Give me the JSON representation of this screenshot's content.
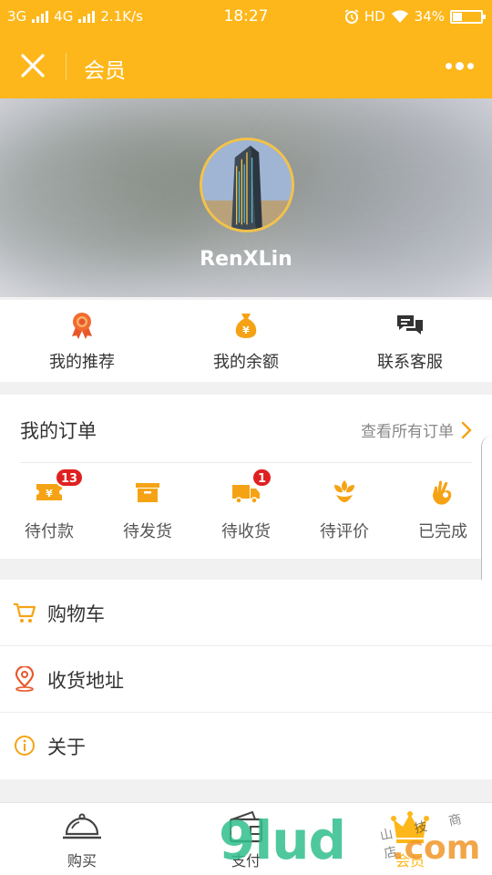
{
  "status_bar": {
    "network_left": "3G",
    "network_right": "4G",
    "speed": "2.1K/s",
    "time": "18:27",
    "hd": "HD",
    "battery": "34%",
    "battery_level": 0.34
  },
  "nav": {
    "title": "会员"
  },
  "profile": {
    "username": "RenXLin"
  },
  "quick_actions": [
    {
      "label": "我的推荐",
      "icon": "ribbon-award-icon"
    },
    {
      "label": "我的余额",
      "icon": "money-bag-icon"
    },
    {
      "label": "联系客服",
      "icon": "chat-bubbles-icon"
    }
  ],
  "orders": {
    "title": "我的订单",
    "view_all": "查看所有订单",
    "items": [
      {
        "label": "待付款",
        "icon": "payment-ticket-icon",
        "badge": "13"
      },
      {
        "label": "待发货",
        "icon": "package-box-icon",
        "badge": ""
      },
      {
        "label": "待收货",
        "icon": "delivery-truck-icon",
        "badge": "1"
      },
      {
        "label": "待评价",
        "icon": "flower-icon",
        "badge": ""
      },
      {
        "label": "已完成",
        "icon": "ok-hand-icon",
        "badge": ""
      }
    ]
  },
  "menu": [
    {
      "label": "购物车",
      "icon": "cart-icon"
    },
    {
      "label": "收货地址",
      "icon": "location-pin-icon"
    },
    {
      "label": "关于",
      "icon": "info-icon"
    }
  ],
  "tabbar": [
    {
      "label": "购买",
      "icon": "food-cloche-icon"
    },
    {
      "label": "支付",
      "icon": "wallet-icon"
    },
    {
      "label": "会员",
      "icon": "crown-icon"
    }
  ],
  "watermark": {
    "text": "9lud",
    "suffix": ".com",
    "cn": "山 技 商 店"
  },
  "colors": {
    "accent": "#fdb71a",
    "badge": "#e02020",
    "icon_orange": "#f5a315",
    "icon_red": "#e8572a"
  }
}
